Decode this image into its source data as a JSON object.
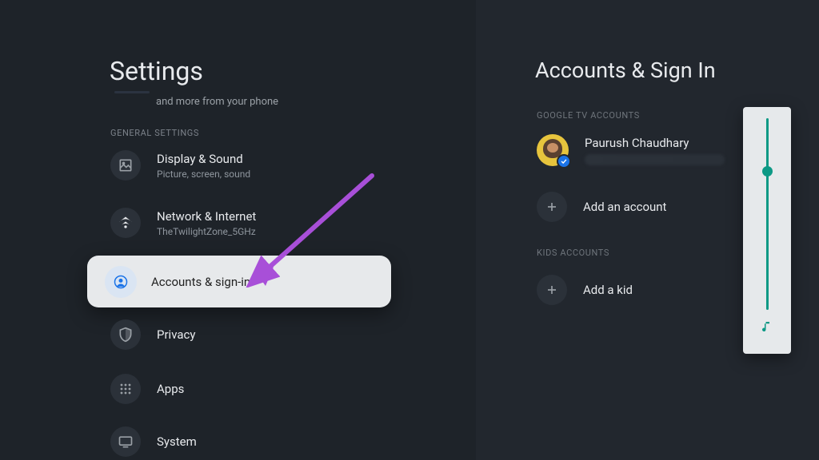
{
  "left": {
    "title": "Settings",
    "hint": "and more from your phone",
    "section_general": "GENERAL SETTINGS",
    "items": {
      "display": {
        "title": "Display & Sound",
        "sub": "Picture, screen, sound"
      },
      "network": {
        "title": "Network & Internet",
        "sub": "TheTwilightZone_5GHz"
      },
      "accounts": {
        "title": "Accounts & sign-in"
      },
      "privacy": {
        "title": "Privacy"
      },
      "apps": {
        "title": "Apps"
      },
      "system": {
        "title": "System"
      }
    }
  },
  "right": {
    "title": "Accounts & Sign In",
    "section_google": "GOOGLE TV ACCOUNTS",
    "section_kids": "KIDS ACCOUNTS",
    "user_name": "Paurush Chaudhary",
    "add_account": "Add an account",
    "add_kid": "Add a kid"
  },
  "annotation": {
    "arrow_color": "#a84fd8"
  },
  "volume": {
    "level_percent": 75
  }
}
